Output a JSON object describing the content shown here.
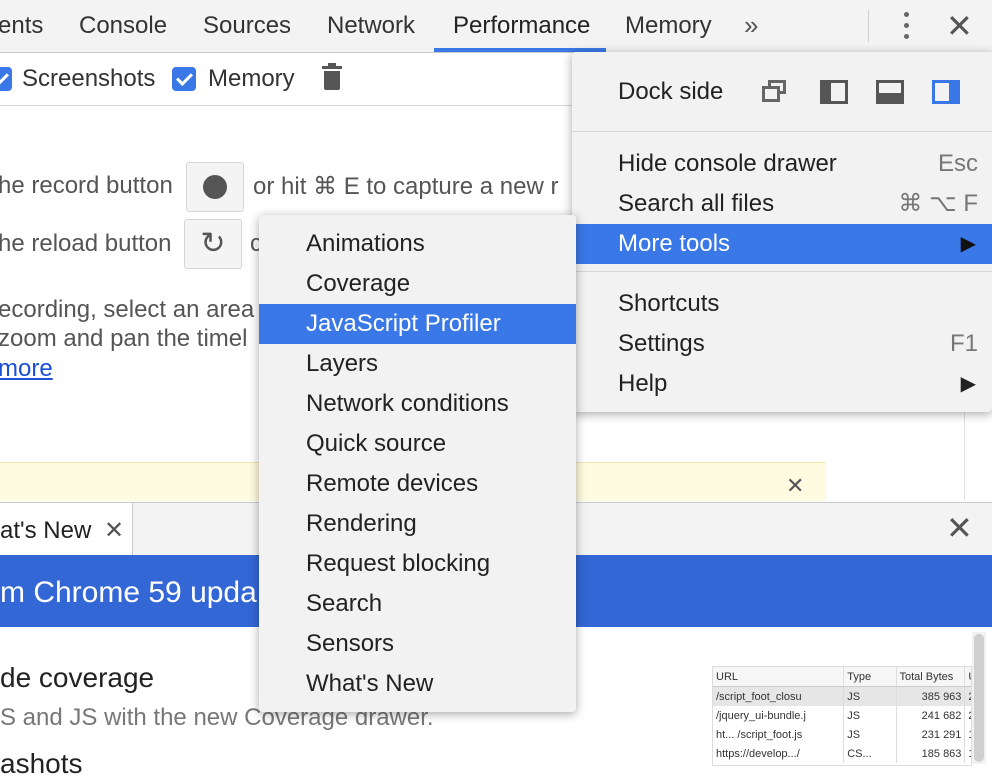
{
  "tabs": [
    {
      "label": "ents"
    },
    {
      "label": "Console"
    },
    {
      "label": "Sources"
    },
    {
      "label": "Network"
    },
    {
      "label": "Performance"
    },
    {
      "label": "Memory"
    }
  ],
  "overflow_glyph": "»",
  "close_glyph": "✕",
  "toolbar": {
    "screenshots_label": "Screenshots",
    "memory_label": "Memory"
  },
  "landing": {
    "line1_prefix": "he record button",
    "line1_suffix": "or hit ⌘ E to capture a new r",
    "line2_prefix": "he reload button",
    "line2_suffix": "c",
    "line3": "ecording, select an area",
    "line4": "zoom and pan the timel",
    "learn_more": "more"
  },
  "main_menu": {
    "dock_label": "Dock side",
    "items": [
      {
        "label": "Hide console drawer",
        "shortcut": "Esc"
      },
      {
        "label": "Search all files",
        "shortcut": "⌘ ⌥ F"
      },
      {
        "label": "More tools",
        "arrow": "▶"
      },
      {
        "label": "Shortcuts"
      },
      {
        "label": "Settings",
        "shortcut": "F1"
      },
      {
        "label": "Help",
        "arrow": "▶"
      }
    ]
  },
  "submenu": {
    "items": [
      "Animations",
      "Coverage",
      "JavaScript Profiler",
      "Layers",
      "Network conditions",
      "Quick source",
      "Remote devices",
      "Rendering",
      "Request blocking",
      "Search",
      "Sensors",
      "What's New"
    ]
  },
  "drawer": {
    "tab_label": "at's New",
    "tab_close": "✕",
    "banner": "m Chrome 59 upda",
    "heading1": "de coverage",
    "para1": "S and JS with the new Coverage drawer.",
    "heading2": "ashots"
  },
  "mini_table": {
    "headers": [
      "URL",
      "Type",
      "Total Bytes",
      "Un"
    ],
    "rows": [
      [
        "/script_foot_closu",
        "JS",
        "385 963",
        "2"
      ],
      [
        "/jquery_ui-bundle.j",
        "JS",
        "241 682",
        "2"
      ],
      [
        "ht... /script_foot.js",
        "JS",
        "231 291",
        "1"
      ],
      [
        "https://develop.../",
        "CS...",
        "185 863",
        "1"
      ]
    ]
  },
  "colors": {
    "accent": "#3b78e7",
    "banner": "#3367d6",
    "link": "#1a4fd6"
  }
}
